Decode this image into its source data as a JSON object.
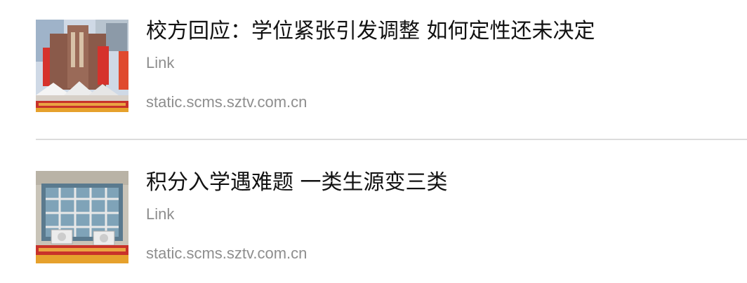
{
  "items": [
    {
      "title": "校方回应：学位紧张引发调整 如何定性还未决定",
      "label": "Link",
      "domain": "static.scms.sztv.com.cn"
    },
    {
      "title": "积分入学遇难题 一类生源变三类",
      "label": "Link",
      "domain": "static.scms.sztv.com.cn"
    }
  ],
  "colors": {
    "title": "#111111",
    "meta": "#8e8e8e",
    "divider": "#dcdcdc",
    "background": "#ffffff"
  }
}
